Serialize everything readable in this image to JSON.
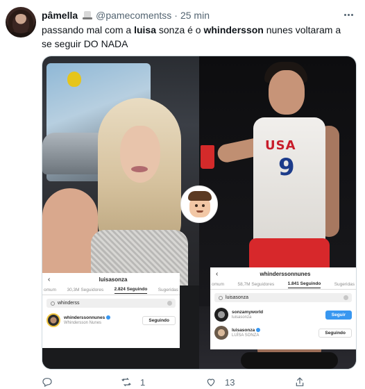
{
  "tweet": {
    "display_name": "pâmella",
    "handle": "@pamecomentss",
    "separator": "·",
    "time": "25 min",
    "text_parts": [
      "passando mal com a ",
      "luisa",
      " sonza é o ",
      "whindersson",
      " nunes voltaram a se seguir DO NADA"
    ]
  },
  "media": {
    "left_ig": {
      "username": "luisasonza",
      "tabs": [
        "omum",
        "30,3M Seguidores",
        "2.824 Seguindo",
        "Sugeridas"
      ],
      "active_tab": 2,
      "search_value": "whinderss",
      "results": [
        {
          "username": "whinderssonnunes",
          "name": "Whindersson Nunes",
          "button": "Seguindo"
        }
      ]
    },
    "right_ig": {
      "username": "whinderssonnunes",
      "tabs": [
        "omum",
        "58,7M Seguidores",
        "1.841 Seguindo",
        "Sugeridas"
      ],
      "active_tab": 2,
      "search_value": "luisasonza",
      "results": [
        {
          "username": "sonzamyworld",
          "name": "luisasonza",
          "button": "Seguir"
        },
        {
          "username": "luisasonza",
          "name": "LUÍSA SONZA",
          "button": "Seguindo"
        }
      ]
    },
    "jersey_text": "USA",
    "jersey_number": "9"
  },
  "actions": {
    "reply_count": "",
    "retweet_count": "1",
    "like_count": "13",
    "icons": [
      "reply-icon",
      "retweet-icon",
      "like-icon",
      "share-icon"
    ]
  },
  "colors": {
    "text": "#0f1419",
    "muted": "#536471",
    "ig_blue": "#3897f0",
    "border": "#cfd9de"
  }
}
